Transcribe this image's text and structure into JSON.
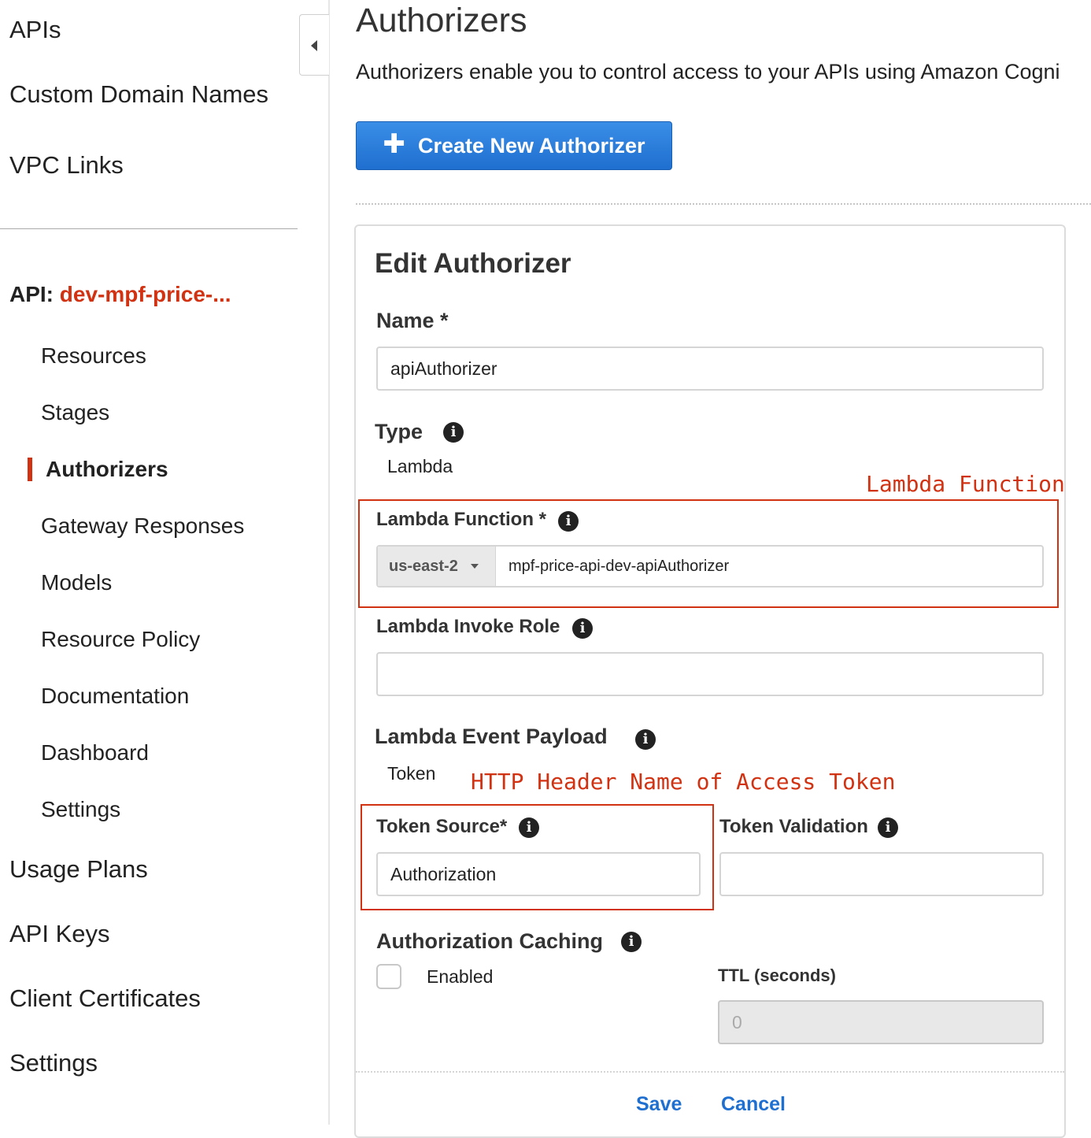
{
  "sidebar": {
    "top_items": [
      {
        "label": "APIs"
      },
      {
        "label": "Custom Domain Names"
      },
      {
        "label": "VPC Links"
      }
    ],
    "api_prefix": "API:",
    "api_name": "dev-mpf-price-...",
    "api_items": [
      {
        "label": "Resources"
      },
      {
        "label": "Stages"
      },
      {
        "label": "Authorizers",
        "active": true
      },
      {
        "label": "Gateway Responses"
      },
      {
        "label": "Models"
      },
      {
        "label": "Resource Policy"
      },
      {
        "label": "Documentation"
      },
      {
        "label": "Dashboard"
      },
      {
        "label": "Settings"
      }
    ],
    "bottom_items": [
      {
        "label": "Usage Plans"
      },
      {
        "label": "API Keys"
      },
      {
        "label": "Client Certificates"
      },
      {
        "label": "Settings"
      }
    ]
  },
  "main": {
    "title": "Authorizers",
    "description": "Authorizers enable you to control access to your APIs using Amazon Cogni",
    "create_button": "Create New Authorizer",
    "form": {
      "title": "Edit Authorizer",
      "name_label": "Name *",
      "name_value": "apiAuthorizer",
      "type_label": "Type",
      "type_value": "Lambda",
      "lambda_function_label": "Lambda Function *",
      "region": "us-east-2",
      "lambda_function_value": "mpf-price-api-dev-apiAuthorizer",
      "invoke_role_label": "Lambda Invoke Role",
      "invoke_role_value": "",
      "event_payload_label": "Lambda Event Payload",
      "event_payload_value": "Token",
      "token_source_label": "Token Source*",
      "token_source_value": "Authorization",
      "token_validation_label": "Token Validation",
      "token_validation_value": "",
      "caching_label": "Authorization Caching",
      "caching_enabled_label": "Enabled",
      "caching_enabled": false,
      "ttl_label": "TTL (seconds)",
      "ttl_value": "0",
      "save_label": "Save",
      "cancel_label": "Cancel"
    }
  },
  "annotations": {
    "lambda_function": "Lambda Function",
    "token_header": "HTTP Header Name of Access Token"
  },
  "colors": {
    "accent_red": "#d13212",
    "primary_blue": "#1f6fd0"
  }
}
